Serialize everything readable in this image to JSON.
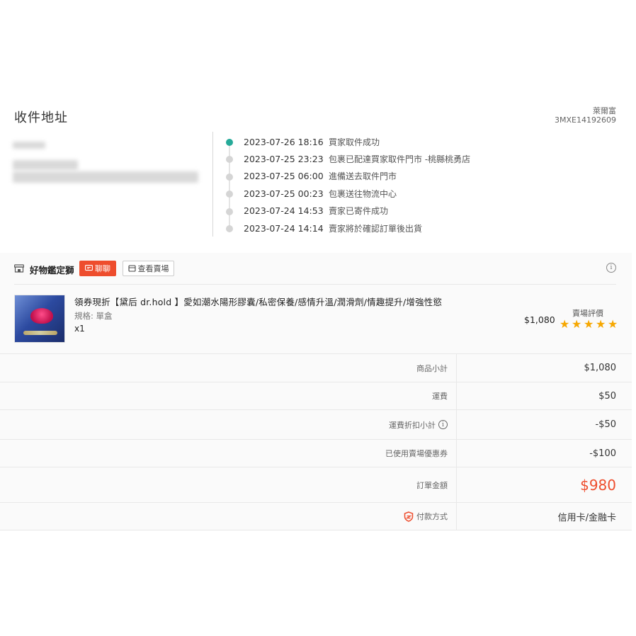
{
  "address": {
    "title": "收件地址",
    "carrier_name": "萊爾富",
    "tracking_no": "3MXE14192609"
  },
  "timeline": [
    {
      "time": "2023-07-26 18:16",
      "desc": "買家取件成功",
      "active": true
    },
    {
      "time": "2023-07-25 23:23",
      "desc": "包裹已配達買家取件門市 -桃縣桃勇店",
      "active": false
    },
    {
      "time": "2023-07-25 06:00",
      "desc": "進備送去取件門市",
      "active": false
    },
    {
      "time": "2023-07-25 00:23",
      "desc": "包裹送往物流中心",
      "active": false
    },
    {
      "time": "2023-07-24 14:53",
      "desc": "賣家已寄件成功",
      "active": false
    },
    {
      "time": "2023-07-24 14:14",
      "desc": "賣家將於確認訂單後出貨",
      "active": false
    }
  ],
  "shop": {
    "name": "好物鑑定獅",
    "chat_label": "聊聊",
    "view_shop_label": "查看賣場"
  },
  "product": {
    "name": "領券現折【黛后 dr.hold 】愛如潮水陽形膠囊/私密保養/感情升溫/潤滑劑/情趣提升/增強性慾",
    "spec": "規格: 單盒",
    "qty": "x1",
    "price": "$1,080",
    "rating_label": "賣場評價",
    "rating_stars": 5
  },
  "summary": [
    {
      "label": "商品小計",
      "value": "$1,080"
    },
    {
      "label": "運費",
      "value": "$50"
    },
    {
      "label": "運費折扣小計",
      "value": "-$50"
    },
    {
      "label": "已使用賣場優惠券",
      "value": "-$100"
    },
    {
      "label": "訂單金額",
      "value": "$980"
    },
    {
      "label": "付款方式",
      "value": "信用卡/金融卡"
    }
  ],
  "colors": {
    "accent": "#ee4d2d",
    "timeline_active": "#26aa99",
    "star": "#f6a700"
  }
}
